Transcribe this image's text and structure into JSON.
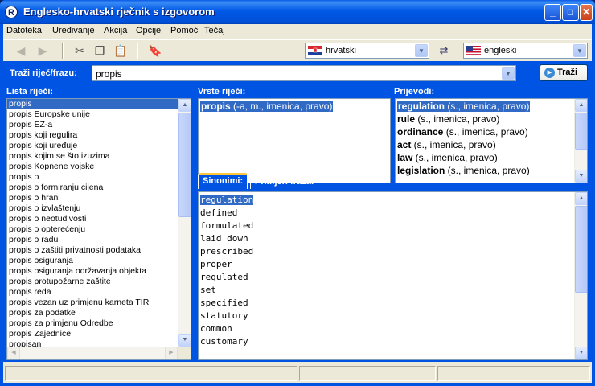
{
  "window": {
    "title": "Englesko-hrvatski rječnik s izgovorom",
    "icon_letter": "R"
  },
  "menu": [
    "Datoteka",
    "Uređivanje",
    "Akcija",
    "Opcije",
    "Pomoć",
    "Tečaj"
  ],
  "toolbar": {
    "lang_from": "hrvatski",
    "lang_to": "engleski",
    "icons": [
      "back-arrow-icon",
      "forward-arrow-icon",
      "scissors-icon",
      "copy-icon",
      "paste-icon",
      "bookmark-icon",
      "swap-languages-icon"
    ]
  },
  "search": {
    "label": "Traži riječ/frazu:",
    "value": "propis",
    "button": "Traži"
  },
  "word_list": {
    "label": "Lista riječi:",
    "items": [
      "propis",
      "propis Europske unije",
      "propis EZ-a",
      "propis koji regulira",
      "propis koji uređuje",
      "propis kojim se što izuzima",
      "propis Kopnene vojske",
      "propis o",
      "propis o formiranju cijena",
      "propis o hrani",
      "propis o izvlaštenju",
      "propis o neotuđivosti",
      "propis o opterećenju",
      "propis o radu",
      "propis o zaštiti privatnosti podataka",
      "propis osiguranja",
      "propis osiguranja održavanja objekta",
      "propis protupožarne zaštite",
      "propis reda",
      "propis vezan uz primjenu karneta TIR",
      "propis za podatke",
      "propis za primjenu Odredbe",
      "propis Zajednice",
      "propisan"
    ],
    "selected": 0
  },
  "word_types": {
    "label": "Vrste riječi:",
    "word": "propis",
    "info": " (-a, m., imenica, pravo)"
  },
  "translations": {
    "label": "Prijevodi:",
    "items": [
      {
        "word": "regulation",
        "info": " (s., imenica, pravo)"
      },
      {
        "word": "rule",
        "info": " (s., imenica, pravo)"
      },
      {
        "word": "ordinance",
        "info": " (s., imenica, pravo)"
      },
      {
        "word": "act",
        "info": " (s., imenica, pravo)"
      },
      {
        "word": "law",
        "info": " (s., imenica, pravo)"
      },
      {
        "word": "legislation",
        "info": " (s., imenica, pravo)"
      }
    ]
  },
  "tabs": {
    "synonyms": "Sinonimi:",
    "examples": "Primjeri fraza:"
  },
  "synonyms": [
    "regulation",
    "defined",
    "formulated",
    "laid down",
    "prescribed",
    "proper",
    "regulated",
    "set",
    "specified",
    "statutory",
    "common",
    "customary"
  ]
}
